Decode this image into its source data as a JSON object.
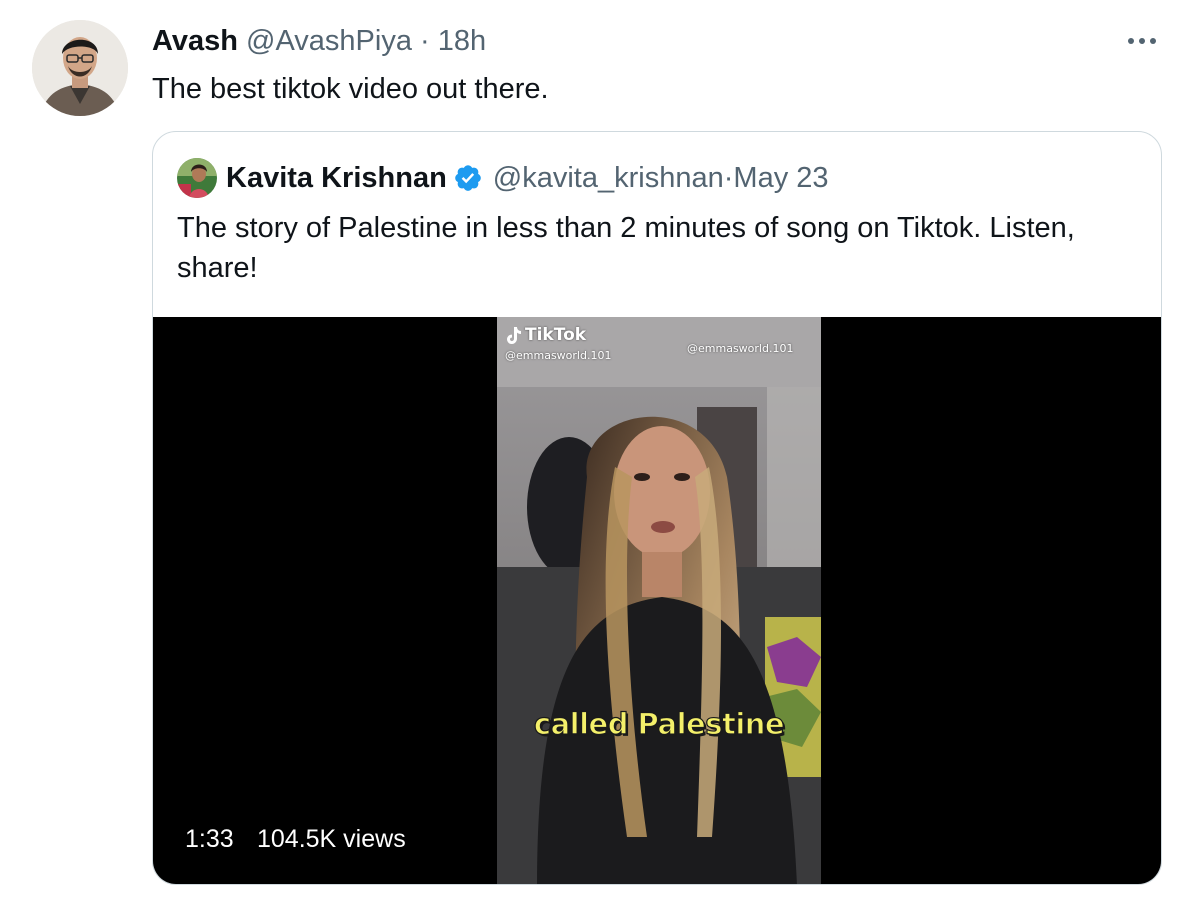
{
  "tweet": {
    "author_name": "Avash",
    "author_handle": "@AvashPiya",
    "separator": "·",
    "time": "18h",
    "text": "The best tiktok video out there.",
    "more_icon": "ellipsis-icon"
  },
  "quoted": {
    "author_name": "Kavita Krishnan",
    "verified_icon": "verified-badge-icon",
    "author_handle": "@kavita_krishnan",
    "separator": "·",
    "date": "May 23",
    "text": "The story of Palestine in less than 2 minutes of song on Tiktok. Listen, share!",
    "video": {
      "watermark_brand": "TikTok",
      "watermark_handle_1": "@emmasworld.101",
      "watermark_handle_2": "@emmasworld.101",
      "caption": "called Palestine",
      "duration": "1:33",
      "views": "104.5K views"
    }
  },
  "colors": {
    "text_primary": "#0f1419",
    "text_secondary": "#536471",
    "border": "#cfd9de",
    "verified_blue": "#1d9bf0",
    "caption_yellow": "#f4f06a"
  }
}
